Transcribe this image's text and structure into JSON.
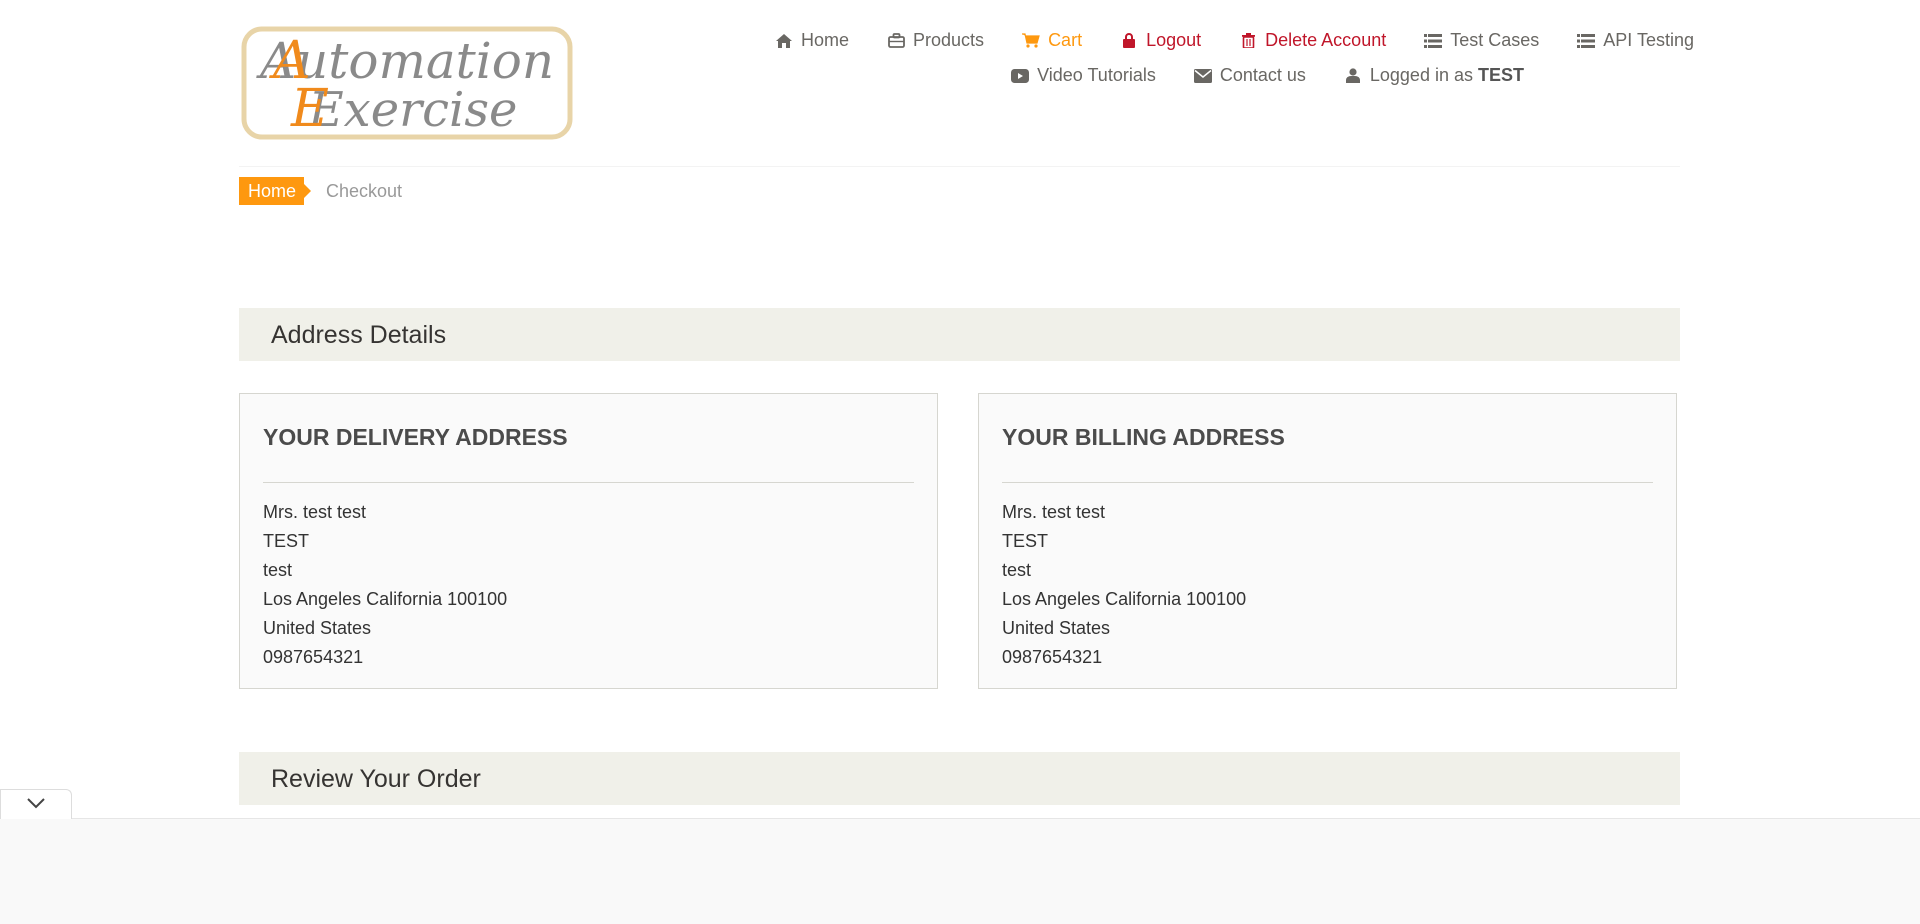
{
  "brand": {
    "logo_line1": "Automation",
    "logo_line2": "Exercise",
    "accent_color": "#FE980F",
    "danger_color": "#c0162a"
  },
  "nav": {
    "row1": [
      {
        "label": "Home",
        "icon": "home-icon"
      },
      {
        "label": "Products",
        "icon": "briefcase-icon"
      },
      {
        "label": "Cart",
        "icon": "cart-icon"
      },
      {
        "label": "Logout",
        "icon": "lock-icon"
      },
      {
        "label": "Delete Account",
        "icon": "trash-icon"
      },
      {
        "label": "Test Cases",
        "icon": "list-icon"
      },
      {
        "label": "API Testing",
        "icon": "list-icon"
      }
    ],
    "row2": [
      {
        "label": "Video Tutorials",
        "icon": "youtube-icon"
      },
      {
        "label": "Contact us",
        "icon": "envelope-icon"
      },
      {
        "label": "Logged in as",
        "icon": "user-icon",
        "username": "TEST"
      }
    ]
  },
  "breadcrumb": {
    "home": "Home",
    "current": "Checkout"
  },
  "address_section": {
    "title": "Address Details",
    "delivery": {
      "heading": "YOUR DELIVERY ADDRESS",
      "lines": [
        "Mrs. test test",
        "TEST",
        "test",
        "Los Angeles California 100100",
        "United States",
        "0987654321"
      ]
    },
    "billing": {
      "heading": "YOUR BILLING ADDRESS",
      "lines": [
        "Mrs. test test",
        "TEST",
        "test",
        "Los Angeles California 100100",
        "United States",
        "0987654321"
      ]
    }
  },
  "review_section": {
    "title": "Review Your Order"
  },
  "widgets": {
    "collapse_icon": "chevron-down-icon"
  }
}
